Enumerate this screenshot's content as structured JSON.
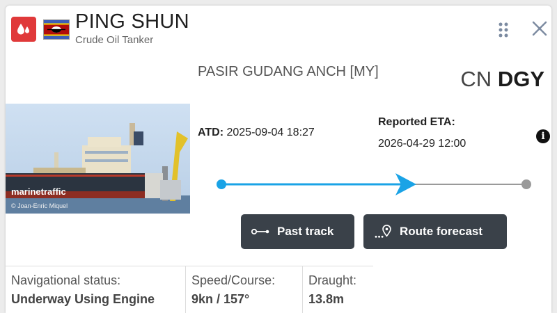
{
  "vessel": {
    "name": "PING SHUN",
    "type": "Crude Oil Tanker",
    "type_icon": "oil-drop-icon",
    "flag": "eswatini-flag",
    "accent": "#e0393a"
  },
  "photo": {
    "brand": "marinetraffic",
    "credit": "© Joan-Enric Miquel"
  },
  "destination": {
    "port": "PASIR GUDANG ANCH [MY]",
    "locode_country": "CN",
    "locode_port": "DGY"
  },
  "voyage": {
    "atd_label": "ATD:",
    "atd_value": "2025-09-04 18:27",
    "eta_label": "Reported ETA:",
    "eta_value": "2026-04-29 12:00",
    "info_glyph": "i",
    "progress": 0.63,
    "progress_color": "#1aa3e6"
  },
  "actions": {
    "past_track": "Past track",
    "route_forecast": "Route forecast"
  },
  "stats": {
    "nav_label": "Navigational status:",
    "nav_value": "Underway Using Engine",
    "speed_label": "Speed/Course:",
    "speed_value": "9kn / 157°",
    "draught_label": "Draught:",
    "draught_value": "13.8m"
  }
}
